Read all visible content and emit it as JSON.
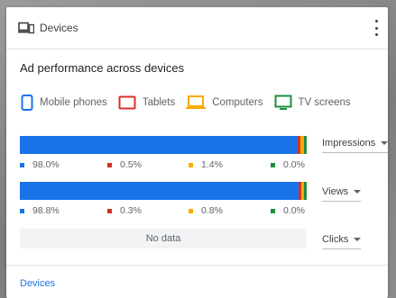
{
  "card": {
    "title": "Devices",
    "title_icon": "devices-icon",
    "menu_icon": "more-vert-icon",
    "section_title": "Ad performance across devices"
  },
  "legend": [
    {
      "label": "Mobile phones",
      "icon": "mobile-phone-icon",
      "color": "#1a73e8"
    },
    {
      "label": "Tablets",
      "icon": "tablet-icon",
      "color": "#d93025"
    },
    {
      "label": "Computers",
      "icon": "computer-icon",
      "color": "#f9ab00"
    },
    {
      "label": "TV screens",
      "icon": "tv-screen-icon",
      "color": "#1e8e3e"
    }
  ],
  "metrics": [
    {
      "selector_label": "Impressions",
      "shares": [
        0.98,
        0.005,
        0.014,
        0.0
      ],
      "labels": [
        "98.0%",
        "0.5%",
        "1.4%",
        "0.0%"
      ]
    },
    {
      "selector_label": "Views",
      "shares": [
        0.988,
        0.003,
        0.008,
        0.0
      ],
      "labels": [
        "98.8%",
        "0.3%",
        "0.8%",
        "0.0%"
      ]
    },
    {
      "selector_label": "Clicks",
      "no_data_text": "No data"
    }
  ],
  "footer": {
    "link_label": "Devices"
  }
}
